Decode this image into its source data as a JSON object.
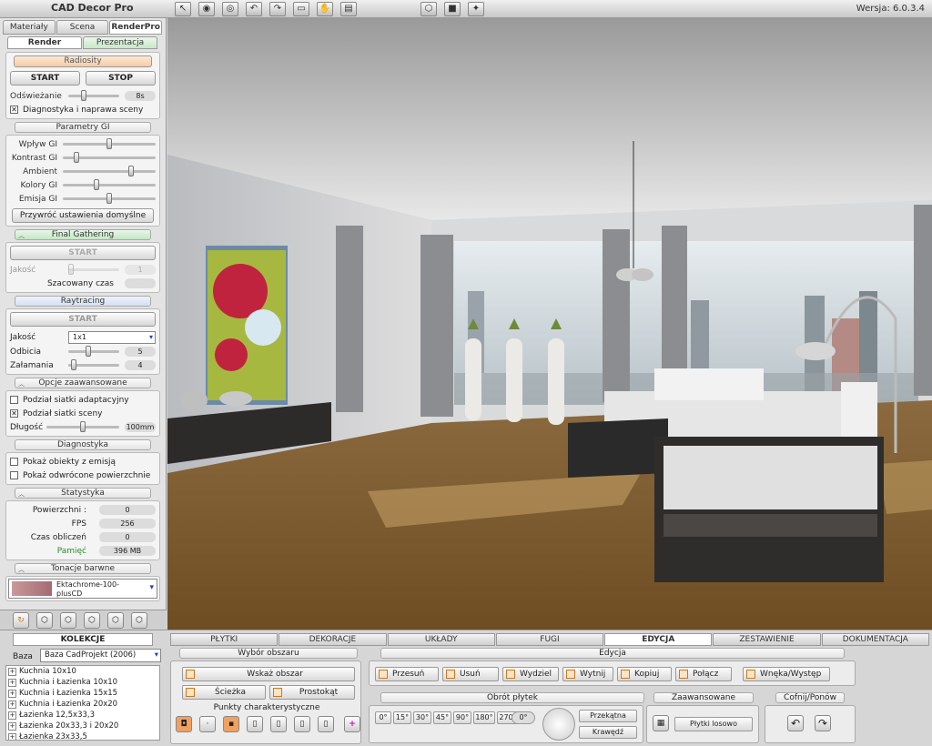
{
  "app": {
    "title": "CAD Decor Pro",
    "version": "Wersja: 6.0.3.4"
  },
  "toolbar": {
    "icons": [
      "cursor-icon",
      "eye-icon",
      "eye-alt-icon",
      "undo-icon",
      "redo-icon",
      "cut-icon",
      "hand-icon",
      "print-icon",
      "cube-view-icon",
      "cube-solid-icon",
      "render-icon"
    ]
  },
  "left": {
    "tabs": [
      "Materiały",
      "Scena",
      "RenderPro"
    ],
    "subtabs": [
      "Render",
      "Prezentacja"
    ],
    "radiosity": {
      "title": "Radiosity",
      "start": "START",
      "stop": "STOP",
      "refresh_label": "Odświeżanie",
      "refresh_value": "8s",
      "refresh_level": 0.3,
      "diag_label": "Diagnostyka i naprawa sceny"
    },
    "gi": {
      "title": "Parametry GI",
      "rows": [
        {
          "label": "Wpływ GI",
          "level": 0.5
        },
        {
          "label": "Kontrast GI",
          "level": 0.15
        },
        {
          "label": "Ambient",
          "level": 0.74
        },
        {
          "label": "Kolory GI",
          "level": 0.36
        },
        {
          "label": "Emisja GI",
          "level": 0.5
        }
      ],
      "reset": "Przywróć ustawienia domyślne"
    },
    "fg": {
      "title": "Final Gathering",
      "start": "START",
      "quality_label": "Jakość",
      "quality_value": "1",
      "time_label": "Szacowany czas"
    },
    "rt": {
      "title": "Raytracing",
      "start": "START",
      "quality_label": "Jakość",
      "quality_value": "1x1",
      "refl_label": "Odbicia",
      "refl_value": "5",
      "refl_level": 0.4,
      "refr_label": "Załamania",
      "refr_value": "4",
      "refr_level": 0.1
    },
    "adv": {
      "title": "Opcje zaawansowane",
      "adaptive": "Podział siatki adaptacyjny",
      "mesh": "Podział siatki sceny",
      "len_label": "Długość",
      "len_value": "100mm",
      "len_level": 0.5
    },
    "diag": {
      "title": "Diagnostyka",
      "emit": "Pokaż obiekty z emisją",
      "inverted": "Pokaż odwrócone powierzchnie"
    },
    "stats": {
      "title": "Statystyka",
      "rows": [
        {
          "label": "Powierzchni :",
          "value": "0"
        },
        {
          "label": "FPS",
          "value": "256"
        },
        {
          "label": "Czas obliczeń",
          "value": "0"
        },
        {
          "label": "Pamięć",
          "value": "396 MB"
        }
      ]
    },
    "tone": {
      "title": "Tonacje barwne",
      "value": "Ektachrome-100-plusCD"
    }
  },
  "bottom": {
    "tabs": [
      "PŁYTKI",
      "DEKORACJE",
      "UKŁADY",
      "FUGI",
      "EDYCJA",
      "ZESTAWIENIE",
      "DOKUMENTACJA"
    ],
    "active_tab": "EDYCJA",
    "collections": {
      "title": "KOLEKCJE",
      "base_label": "Baza",
      "base_value": "Baza CadProjekt (2006)",
      "items": [
        "Kuchnia 10x10",
        "Kuchnia i Łazienka 10x10",
        "Kuchnia i Łazienka 15x15",
        "Kuchnia i Łazienka 20x20",
        "Łazienka 12,5x33,3",
        "Łazienka 20x33,3 i 20x20",
        "Łazienka 23x33,5"
      ]
    },
    "area": {
      "title": "Wybór obszaru",
      "indicate": "Wskaż obszar",
      "path": "Ścieżka",
      "rect": "Prostokąt",
      "points_title": "Punkty charakterystyczne"
    },
    "edit": {
      "title": "Edycja",
      "buttons": [
        "Przesuń",
        "Usuń",
        "Wydziel",
        "Wytnij",
        "Kopiuj",
        "Połącz",
        "Wnęka/Występ"
      ]
    },
    "rot": {
      "title": "Obrót płytek",
      "angles": [
        "0°",
        "15°",
        "30°",
        "45°",
        "90°",
        "180°",
        "270°"
      ],
      "current": "0°",
      "diag": "Przekątna",
      "edge": "Krawędź"
    },
    "advanced": {
      "title": "Zaawansowane",
      "random": "Płytki losowo"
    },
    "undo": {
      "title": "Cofnij/Ponów"
    }
  }
}
